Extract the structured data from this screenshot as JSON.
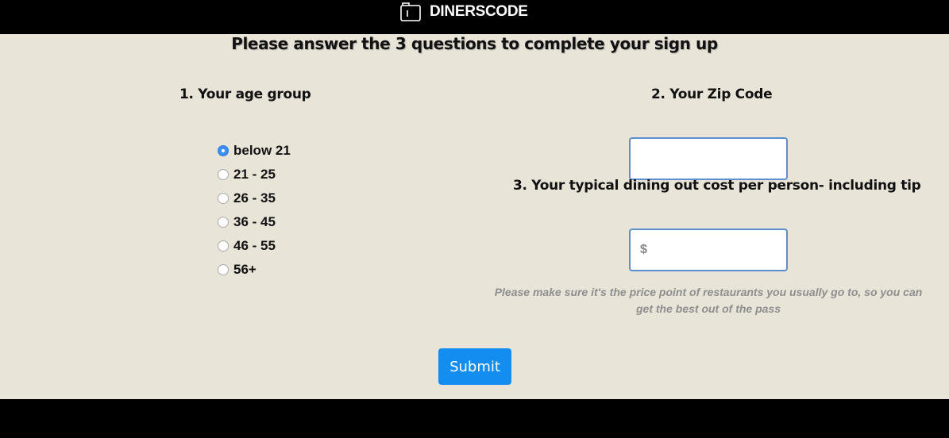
{
  "brand": {
    "name": "DINERSCODE",
    "icon": "diner-logo-icon"
  },
  "form": {
    "heading": "Please answer the 3 questions to complete your sign up",
    "q1": {
      "label": "1. Your age group",
      "options": [
        {
          "label": "below 21",
          "checked": true
        },
        {
          "label": "21 - 25",
          "checked": false
        },
        {
          "label": "26 - 35",
          "checked": false
        },
        {
          "label": "36 - 45",
          "checked": false
        },
        {
          "label": "46 - 55",
          "checked": false
        },
        {
          "label": "56+",
          "checked": false
        }
      ]
    },
    "q2": {
      "label": "2. Your Zip Code",
      "value": "",
      "placeholder": ""
    },
    "q3": {
      "label": "3. Your typical dining out cost per person- including tip",
      "value": "",
      "placeholder": "$",
      "hint": "Please make sure it's the price point of restaurants you usually go to, so you can get the best out of the pass"
    },
    "submit_label": "Submit"
  },
  "colors": {
    "panel_bg": "#e8e4d8",
    "accent": "#138ef0",
    "input_border": "#5a8fd0",
    "hint_text": "#8e8e8e"
  }
}
